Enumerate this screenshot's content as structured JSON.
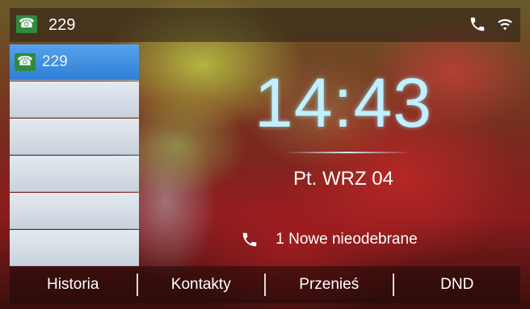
{
  "status_bar": {
    "account": "229",
    "icons": [
      "phone-icon",
      "wifi-icon"
    ]
  },
  "line_keys": [
    {
      "label": "229",
      "icon": "phone-icon",
      "active": true
    },
    {
      "label": "",
      "active": false
    },
    {
      "label": "",
      "active": false
    },
    {
      "label": "",
      "active": false
    },
    {
      "label": "",
      "active": false
    },
    {
      "label": "",
      "active": false
    }
  ],
  "clock": {
    "time": "14:43",
    "date": "Pt. WRZ 04"
  },
  "notification": {
    "missed_calls": "1 Nowe nieodebrane"
  },
  "softkeys": [
    "Historia",
    "Kontakty",
    "Przenieś",
    "DND"
  ],
  "colors": {
    "line_badge": "#2f8a3f",
    "active_line": "#3d8de0",
    "clock": "#bff0ff"
  }
}
